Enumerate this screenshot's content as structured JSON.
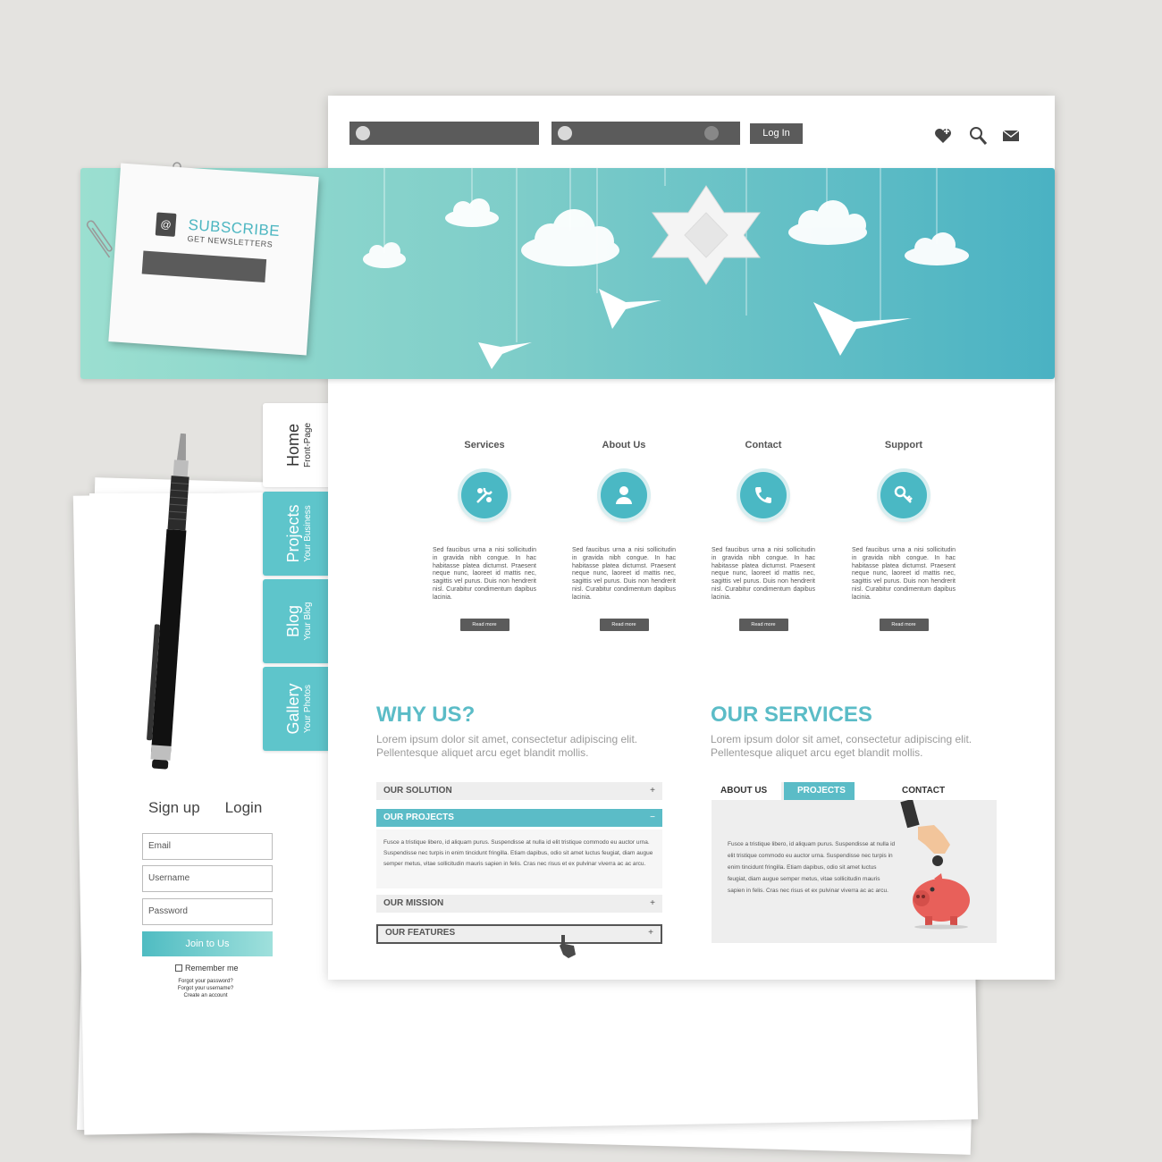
{
  "topbar": {
    "login_label": "Log In"
  },
  "subscribe": {
    "title": "SUBSCRIBE",
    "subtitle": "GET NEWSLETTERS"
  },
  "side_tabs": [
    {
      "label": "Home",
      "sub": "Front-Page"
    },
    {
      "label": "Projects",
      "sub": "Your Business"
    },
    {
      "label": "Blog",
      "sub": "Your Blog"
    },
    {
      "label": "Gallery",
      "sub": "Your Photos"
    }
  ],
  "signup": {
    "tab_signup": "Sign up",
    "tab_login": "Login",
    "email_placeholder": "Email",
    "username_placeholder": "Username",
    "password_placeholder": "Password",
    "join_label": "Join to Us",
    "remember_label": "Remember me",
    "link_forgot_password": "Forgot your password?",
    "link_forgot_username": "Forgot your username?",
    "link_create_account": "Create an account"
  },
  "features": [
    {
      "title": "Services",
      "icon": "tools-icon",
      "text": "Sed faucibus urna a nisi sollicitudin in gravida nibh congue. In hac habitasse platea dictumst. Praesent neque nunc, laoreet id mattis nec, sagittis vel purus. Duis non hendrerit nisl. Curabitur condimentum dapibus lacinia.",
      "button": "Read more"
    },
    {
      "title": "About Us",
      "icon": "user-icon",
      "text": "Sed faucibus urna a nisi sollicitudin in gravida nibh congue. In hac habitasse platea dictumst. Praesent neque nunc, laoreet id mattis nec, sagittis vel purus. Duis non hendrerit nisl. Curabitur condimentum dapibus lacinia.",
      "button": "Read more"
    },
    {
      "title": "Contact",
      "icon": "phone-icon",
      "text": "Sed faucibus urna a nisi sollicitudin in gravida nibh congue. In hac habitasse platea dictumst. Praesent neque nunc, laoreet id mattis nec, sagittis vel purus. Duis non hendrerit nisl. Curabitur condimentum dapibus lacinia.",
      "button": "Read more"
    },
    {
      "title": "Support",
      "icon": "key-icon",
      "text": "Sed faucibus urna a nisi sollicitudin in gravida nibh congue. In hac habitasse platea dictumst. Praesent neque nunc, laoreet id mattis nec, sagittis vel purus. Duis non hendrerit nisl. Curabitur condimentum dapibus lacinia.",
      "button": "Read more"
    }
  ],
  "why_us": {
    "title": "WHY US?",
    "subtitle": "Lorem ipsum dolor sit amet, consectetur adipiscing elit. Pellentesque aliquet arcu eget blandit mollis.",
    "accordion": [
      {
        "label": "OUR SOLUTION",
        "sign": "+"
      },
      {
        "label": "OUR PROJECTS",
        "sign": "−"
      },
      {
        "label": "OUR MISSION",
        "sign": "+"
      },
      {
        "label": "OUR FEATURES",
        "sign": "+"
      }
    ],
    "open_text": "Fusce a tristique libero, id aliquam purus. Suspendisse at nulla id elit tristique commodo eu auctor urna. Suspendisse nec turpis in enim tincidunt fringilla. Etiam dapibus, odio sit amet luctus feugiat, diam augue semper metus, vitae sollicitudin mauris sapien in felis. Cras nec risus et ex pulvinar viverra ac ac arcu."
  },
  "our_services": {
    "title": "OUR SERVICES",
    "subtitle": "Lorem ipsum dolor sit amet, consectetur adipiscing elit. Pellentesque aliquet arcu eget blandit mollis.",
    "tabs": [
      "ABOUT US",
      "PROJECTS",
      "CONTACT"
    ],
    "text": "Fusce a tristique libero, id aliquam purus. Suspendisse at nulla id elit tristique commodo eu auctor urna. Suspendisse nec turpis in enim tincidunt fringilla. Etiam dapibus, odio sit amet luctus feugiat, diam augue semper metus, vitae sollicitudin mauris sapien in felis. Cras nec risus et ex pulvinar viverra ac ac arcu."
  },
  "colors": {
    "accent": "#5bbcc7",
    "dark": "#5b5b5b",
    "piggy": "#e8605a"
  }
}
